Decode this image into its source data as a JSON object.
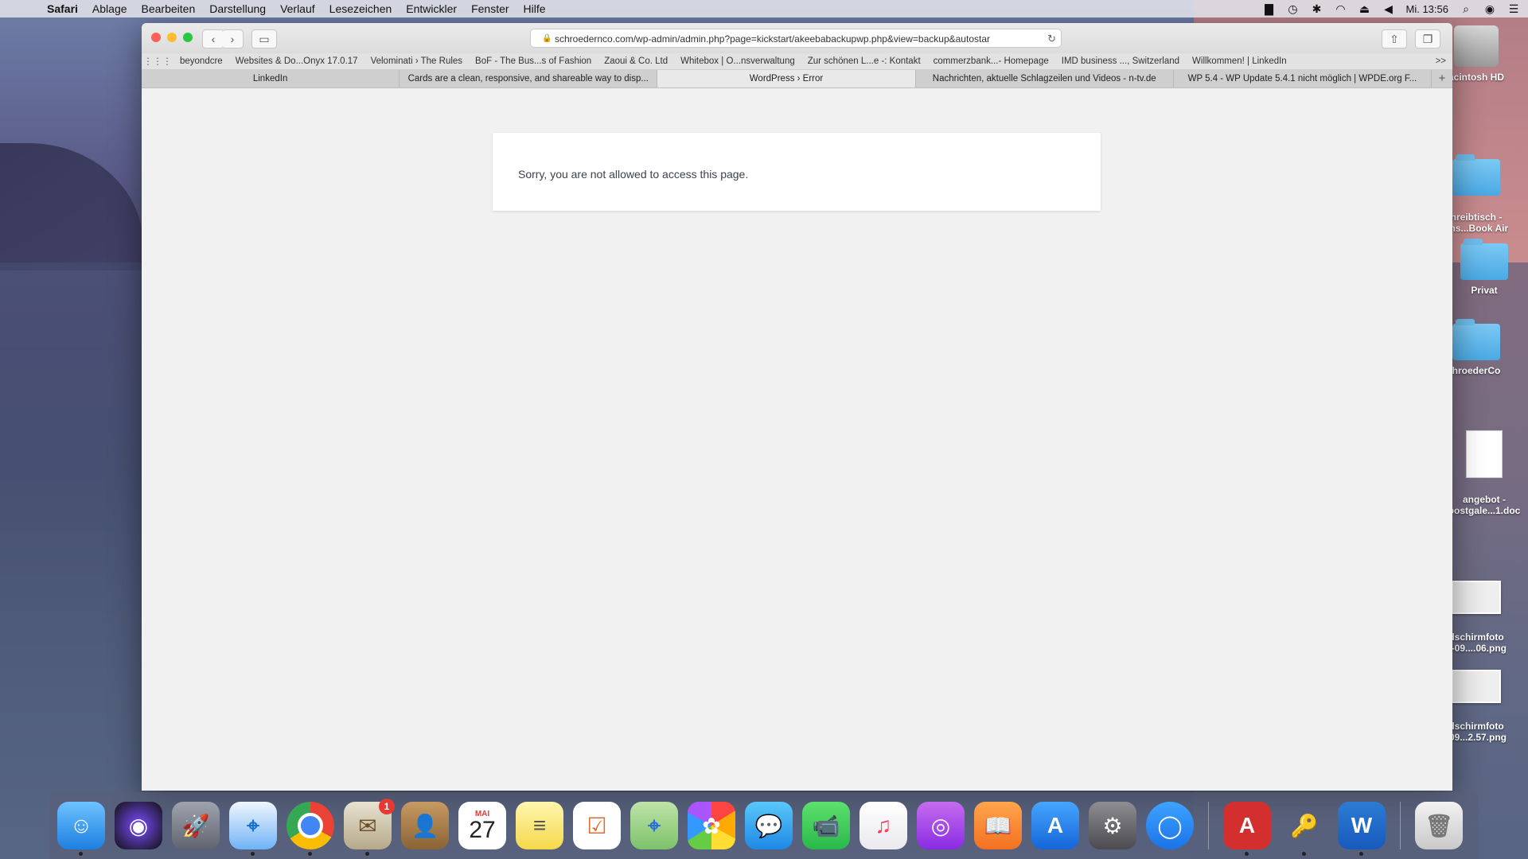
{
  "menubar": {
    "app": "Safari",
    "items": [
      "Ablage",
      "Bearbeiten",
      "Darstellung",
      "Verlauf",
      "Lesezeichen",
      "Entwickler",
      "Fenster",
      "Hilfe"
    ],
    "clock": "Mi. 13:56"
  },
  "browser": {
    "url": "schroedernco.com/wp-admin/admin.php?page=kickstart/akeebabackupwp.php&view=backup&autostar",
    "bookmarks": [
      "beyondcre",
      "Websites & Do...Onyx 17.0.17",
      "Velominati › The Rules",
      "BoF - The Bus...s of Fashion",
      "Zaoui & Co. Ltd",
      "Whitebox | O...nsverwaltung",
      "Zur schönen L...e -: Kontakt",
      "commerzbank...- Homepage",
      "IMD business ..., Switzerland",
      "Willkommen! | LinkedIn"
    ],
    "bookmarks_more": ">>",
    "tabs": [
      {
        "label": "LinkedIn",
        "active": false
      },
      {
        "label": "Cards are a clean, responsive, and shareable way to disp...",
        "active": false
      },
      {
        "label": "WordPress › Error",
        "active": true
      },
      {
        "label": "Nachrichten, aktuelle Schlagzeilen und Videos - n-tv.de",
        "active": false
      },
      {
        "label": "WP 5.4 - WP Update 5.4.1 nicht möglich | WPDE.org F...",
        "active": false
      }
    ],
    "error_message": "Sorry, you are not allowed to access this page."
  },
  "desktop_icons": [
    {
      "label": "acintosh HD",
      "type": "hd"
    },
    {
      "label": "hreibtisch -\nens...Book Air",
      "type": "folder"
    },
    {
      "label": "Privat",
      "type": "folder"
    },
    {
      "label": "hroederCo",
      "type": "folder"
    },
    {
      "label": "angebot -\npostgale...1.doc",
      "type": "doc"
    },
    {
      "label": "dschirmfoto\n7-09....06.png",
      "type": "shot"
    },
    {
      "label": "dschirmfoto\n-09...2.57.png",
      "type": "shot"
    }
  ],
  "dock": {
    "mail_badge": "1",
    "calendar_month": "MAI",
    "calendar_day": "27"
  }
}
